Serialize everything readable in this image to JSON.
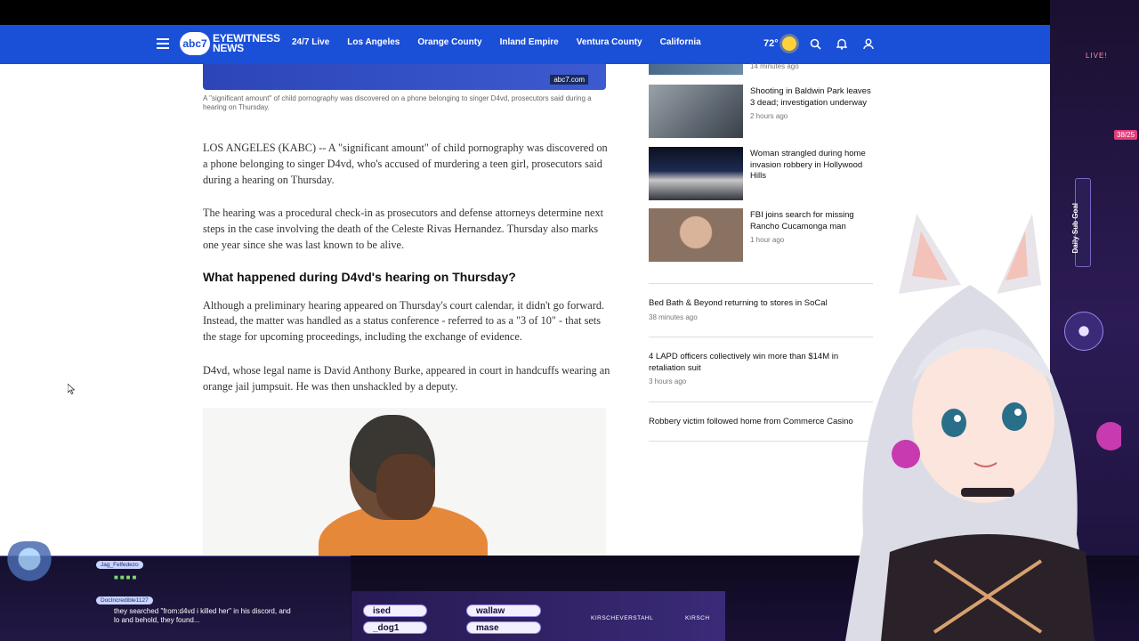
{
  "nav": {
    "logo_badge": "abc7",
    "logo_line1": "EYEWITNESS",
    "logo_line2": "NEWS",
    "links": [
      "24/7 Live",
      "Los Angeles",
      "Orange County",
      "Inland Empire",
      "Ventura County",
      "California"
    ],
    "temperature": "72°"
  },
  "hero": {
    "badge": "abc7.com",
    "caption": "A \"significant amount\" of child pornography was discovered on a phone belonging to singer D4vd, prosecutors said during a hearing on Thursday."
  },
  "article": {
    "p1": "LOS ANGELES (KABC) -- A \"significant amount\" of child pornography was discovered on a phone belonging to singer D4vd, who's accused of murdering a teen girl, prosecutors said during a hearing on Thursday.",
    "p2": "The hearing was a procedural check-in as prosecutors and defense attorneys determine next steps in the case involving the death of the Celeste Rivas Hernandez. Thursday also marks one year since she was last known to be alive.",
    "heading": "What happened during D4vd's hearing on Thursday?",
    "p3": "Although a preliminary hearing appeared on Thursday's court calendar, it didn't go forward. Instead, the matter was handled as a status conference - referred to as a \"3 of 10\" - that sets the stage for upcoming proceedings, including the exchange of evidence.",
    "p4": "D4vd, whose legal name is David Anthony Burke, appeared in court in handcuffs wearing an orange jail jumpsuit. He was then unshackled by a deputy."
  },
  "sidebar": {
    "top_time": "14 minutes ago",
    "stories": [
      {
        "title": "Shooting in Baldwin Park leaves 3 dead; investigation underway",
        "time": "2 hours ago"
      },
      {
        "title": "Woman strangled during home invasion robbery in Hollywood Hills",
        "time": ""
      },
      {
        "title": "FBI joins search for missing Rancho Cucamonga man",
        "time": "1 hour ago"
      }
    ],
    "text_stories": [
      {
        "title": "Bed Bath & Beyond returning to stores in SoCal",
        "time": "38 minutes ago"
      },
      {
        "title": "4 LAPD officers collectively win more than $14M in retaliation suit",
        "time": "3 hours ago"
      },
      {
        "title": "Robbery victim followed home from Commerce Casino",
        "time": ""
      }
    ]
  },
  "overlay": {
    "live": "LIVE!",
    "goal_label": "Daily Sub Goal",
    "goal_count": "38/25",
    "chat": [
      {
        "user": "Jag_Felfedezo",
        "message": ""
      },
      {
        "user": "DocIncredible1127",
        "message": "they searched \"from:d4vd i killed her\" in his discord, and lo and behold, they found..."
      }
    ],
    "ticker_pills": [
      "ised",
      "wallaw",
      "_dog1",
      "mase"
    ],
    "socials": [
      "KIRSCHEVERSTAHL",
      "KIRSCH"
    ]
  }
}
